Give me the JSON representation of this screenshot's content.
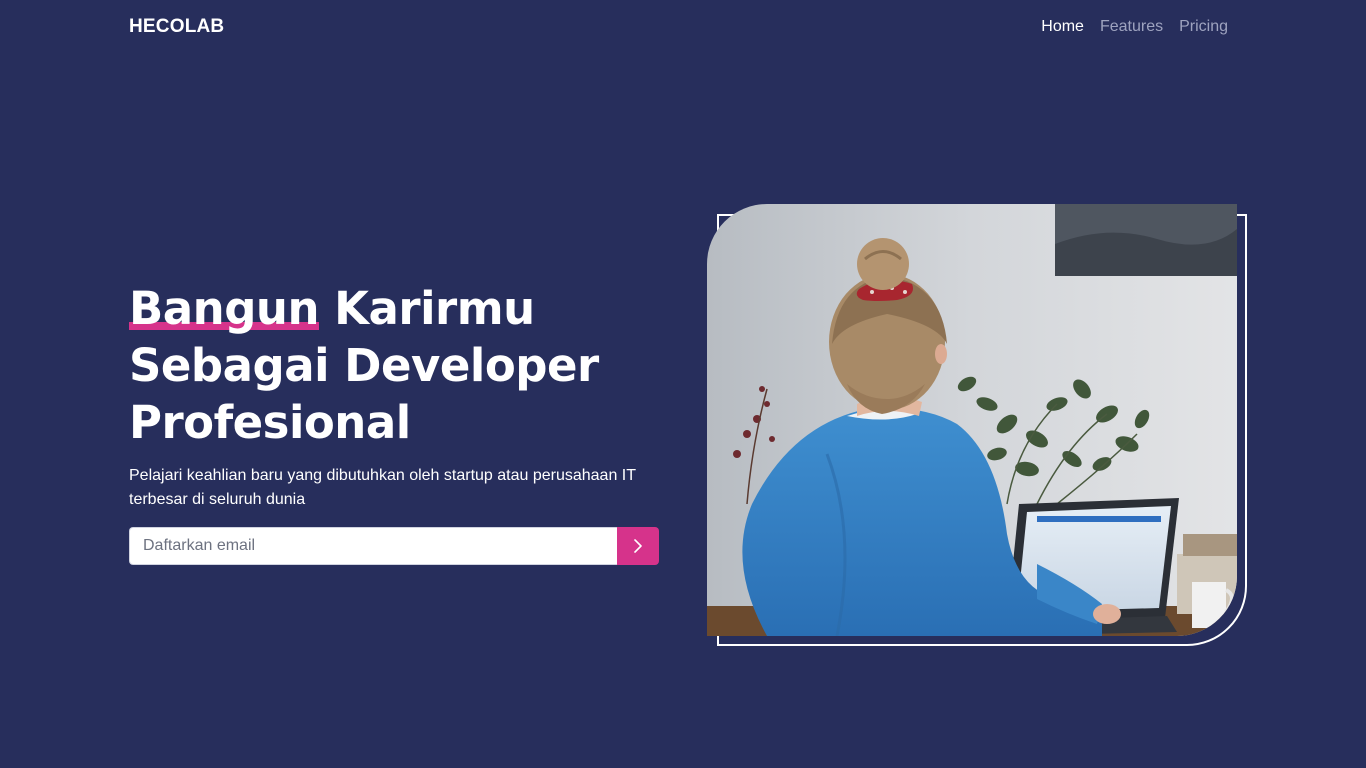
{
  "brand": "HECOLAB",
  "nav": {
    "items": [
      {
        "label": "Home",
        "active": true
      },
      {
        "label": "Features",
        "active": false
      },
      {
        "label": "Pricing",
        "active": false
      }
    ]
  },
  "hero": {
    "title_highlight": "Bangun",
    "title_rest": " Karirmu Sebagai Developer Profesional",
    "subtitle": "Pelajari keahlian baru yang dibutuhkan oleh startup atau perusahaan IT terbesar di seluruh dunia",
    "email_placeholder": "Daftarkan email",
    "submit_icon": "chevron-right-icon"
  },
  "image": {
    "subject": "woman in blue sweater working on laptop"
  },
  "colors": {
    "background": "#272e5c",
    "accent": "#d6338b",
    "text": "#ffffff",
    "nav_inactive": "#9ea3bf"
  }
}
